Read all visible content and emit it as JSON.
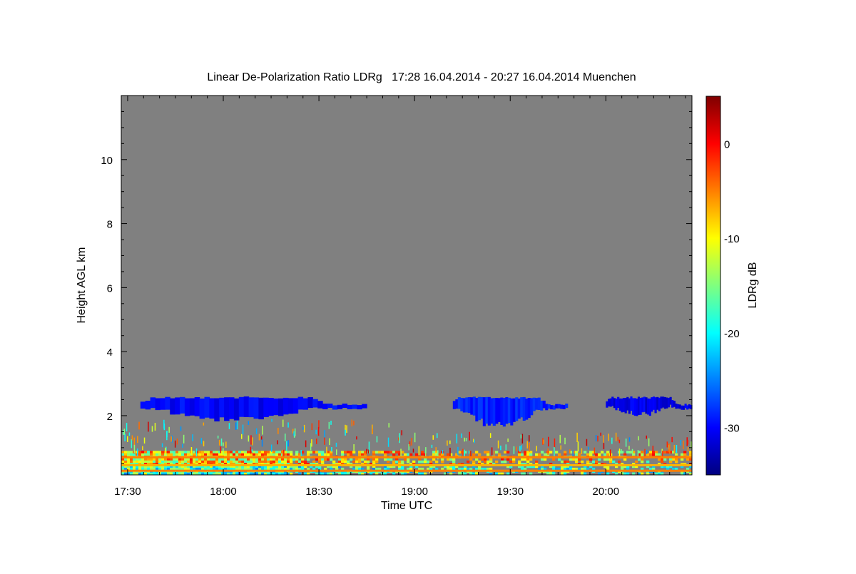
{
  "chart_data": {
    "type": "heatmap",
    "title": "Linear De-Polarization Ratio LDRg   17:28 16.04.2014 - 20:27 16.04.2014 Muenchen",
    "xlabel": "Time UTC",
    "ylabel": "Height AGL km",
    "colorbar_label": "LDRg dB",
    "x_range": [
      "17:28",
      "20:27"
    ],
    "ylim": [
      0.15,
      12
    ],
    "color_range": [
      -35,
      5
    ],
    "x_ticks": [
      "17:30",
      "18:00",
      "18:30",
      "19:00",
      "19:30",
      "20:00"
    ],
    "y_ticks": [
      "2",
      "4",
      "6",
      "8",
      "10"
    ],
    "colorbar_ticks": [
      "0",
      "-10",
      "-20",
      "-30"
    ],
    "background_color": "#808080",
    "colormap": [
      "#00007f",
      "#0000ff",
      "#007fff",
      "#00ffff",
      "#7fff7f",
      "#ffff00",
      "#ff7f00",
      "#ff0000",
      "#7f0000"
    ],
    "cloud_regions": [
      {
        "time_start": "17:34",
        "time_end": "18:45",
        "base_km": 1.8,
        "top_km": 2.6,
        "ldr_db": -30
      },
      {
        "time_start": "19:12",
        "time_end": "19:48",
        "base_km": 1.6,
        "top_km": 2.6,
        "ldr_db": -29
      },
      {
        "time_start": "20:00",
        "time_end": "20:27",
        "base_km": 2.0,
        "top_km": 2.6,
        "ldr_db": -31
      }
    ],
    "near_surface_layer": {
      "base_km": 0.15,
      "top_km": 0.9,
      "ldr_db_range": [
        -25,
        0
      ]
    },
    "horizontal_bands": [
      {
        "height_km": 0.7,
        "ldr_db": -5
      },
      {
        "height_km": 0.45,
        "ldr_db": -7
      },
      {
        "height_km": 0.28,
        "ldr_db": -5
      }
    ]
  }
}
